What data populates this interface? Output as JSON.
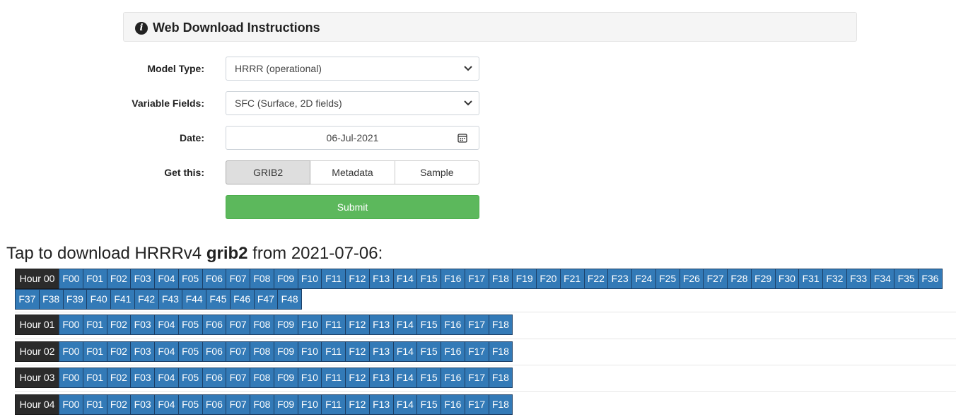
{
  "panel": {
    "title": "Web Download Instructions",
    "icon": "info-circle-icon"
  },
  "form": {
    "model_type": {
      "label": "Model Type:",
      "value": "HRRR (operational)"
    },
    "variable_fields": {
      "label": "Variable Fields:",
      "value": "SFC (Surface, 2D fields)"
    },
    "date": {
      "label": "Date:",
      "value": "06-Jul-2021"
    },
    "get_this": {
      "label": "Get this:",
      "options": [
        "GRIB2",
        "Metadata",
        "Sample"
      ],
      "selected": "GRIB2"
    },
    "submit_label": "Submit"
  },
  "download": {
    "heading_prefix": "Tap to download HRRRv4 ",
    "heading_bold": "grib2",
    "heading_suffix": " from 2021-07-06:",
    "hours": [
      {
        "label": "Hour 00",
        "forecasts": [
          "F00",
          "F01",
          "F02",
          "F03",
          "F04",
          "F05",
          "F06",
          "F07",
          "F08",
          "F09",
          "F10",
          "F11",
          "F12",
          "F13",
          "F14",
          "F15",
          "F16",
          "F17",
          "F18",
          "F19",
          "F20",
          "F21",
          "F22",
          "F23",
          "F24",
          "F25",
          "F26",
          "F27",
          "F28",
          "F29",
          "F30",
          "F31",
          "F32",
          "F33",
          "F34",
          "F35",
          "F36",
          "F37",
          "F38",
          "F39",
          "F40",
          "F41",
          "F42",
          "F43",
          "F44",
          "F45",
          "F46",
          "F47",
          "F48"
        ]
      },
      {
        "label": "Hour 01",
        "forecasts": [
          "F00",
          "F01",
          "F02",
          "F03",
          "F04",
          "F05",
          "F06",
          "F07",
          "F08",
          "F09",
          "F10",
          "F11",
          "F12",
          "F13",
          "F14",
          "F15",
          "F16",
          "F17",
          "F18"
        ]
      },
      {
        "label": "Hour 02",
        "forecasts": [
          "F00",
          "F01",
          "F02",
          "F03",
          "F04",
          "F05",
          "F06",
          "F07",
          "F08",
          "F09",
          "F10",
          "F11",
          "F12",
          "F13",
          "F14",
          "F15",
          "F16",
          "F17",
          "F18"
        ]
      },
      {
        "label": "Hour 03",
        "forecasts": [
          "F00",
          "F01",
          "F02",
          "F03",
          "F04",
          "F05",
          "F06",
          "F07",
          "F08",
          "F09",
          "F10",
          "F11",
          "F12",
          "F13",
          "F14",
          "F15",
          "F16",
          "F17",
          "F18"
        ]
      },
      {
        "label": "Hour 04",
        "forecasts": [
          "F00",
          "F01",
          "F02",
          "F03",
          "F04",
          "F05",
          "F06",
          "F07",
          "F08",
          "F09",
          "F10",
          "F11",
          "F12",
          "F13",
          "F14",
          "F15",
          "F16",
          "F17",
          "F18"
        ]
      }
    ]
  }
}
